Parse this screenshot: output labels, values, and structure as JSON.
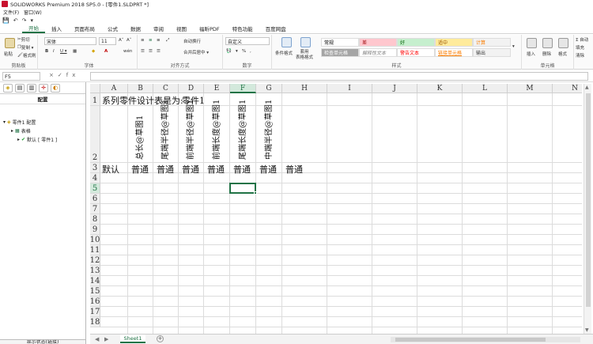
{
  "window": {
    "title": "SOLIDWORKS Premium 2018 SP5.0 - [零件1.SLDPRT *]"
  },
  "menu": [
    "文件(F)",
    "窗口(W)"
  ],
  "ribbon": {
    "tabs": [
      "开始",
      "插入",
      "页面布局",
      "公式",
      "数据",
      "审阅",
      "视图",
      "福昕PDF",
      "特色功能",
      "百度网盘"
    ],
    "clipboard": {
      "paste": "粘贴",
      "cut": "剪切",
      "copy": "复制 ▾",
      "painter": "格式刷",
      "label": "剪贴板"
    },
    "font": {
      "name": "宋体",
      "size": "11",
      "label": "字体",
      "bold": "B",
      "italic": "I",
      "underline": "U ▾",
      "grow": "A˄",
      "shrink": "A˅",
      "wen": "wén"
    },
    "alignment": {
      "wrap": "自动换行",
      "merge": "合并后居中 ▾",
      "label": "对齐方式"
    },
    "number": {
      "format": "自定义",
      "label": "数字",
      "pct": "%",
      "comma": ",",
      "currency": "▾"
    },
    "styles": {
      "cond": "条件格式",
      "table": "套用\n表格格式",
      "cells": [
        {
          "text": "常规",
          "bg": "#ffffff",
          "color": "#000000"
        },
        {
          "text": "差",
          "bg": "#ffc7ce",
          "color": "#9c0006"
        },
        {
          "text": "好",
          "bg": "#c6efce",
          "color": "#006100"
        },
        {
          "text": "适中",
          "bg": "#ffeb9c",
          "color": "#9c5700"
        },
        {
          "text": "计算",
          "bg": "#f2f2f2",
          "color": "#fa7d00"
        },
        {
          "text": "检查单元格",
          "bg": "#a5a5a5",
          "color": "#ffffff"
        },
        {
          "text": "解释性文本",
          "bg": "#ffffff",
          "color": "#7f7f7f"
        },
        {
          "text": "警告文本",
          "bg": "#ffffff",
          "color": "#ff0000"
        },
        {
          "text": "链接单元格",
          "bg": "#ffffff",
          "color": "#fa7d00"
        },
        {
          "text": "输出",
          "bg": "#f2f2f2",
          "color": "#3f3f3f"
        }
      ],
      "label": "样式"
    },
    "cells_group": {
      "insert": "插入",
      "delete": "删除",
      "format": "格式",
      "label": "单元格"
    },
    "editing": {
      "autosum": "Σ 自动",
      "fill": "填充",
      "clear": "清除"
    }
  },
  "formula_bar": {
    "name_box": "F5",
    "fx": "×✓fx",
    "value": ""
  },
  "left_panel": {
    "title": "配置",
    "tree": [
      {
        "label": "零件1 配置",
        "level": 0
      },
      {
        "label": "表格",
        "level": 1
      },
      {
        "label": "默认 [ 零件1 ]",
        "level": 2
      }
    ],
    "bottom": "显示状态(链接)"
  },
  "sheet": {
    "columns": [
      "A",
      "B",
      "C",
      "D",
      "E",
      "F",
      "G",
      "H",
      "I",
      "J",
      "K",
      "L",
      "M",
      "N"
    ],
    "rows": [
      "1",
      "2",
      "3",
      "4",
      "5",
      "6",
      "7",
      "8",
      "9",
      "10",
      "11",
      "12",
      "13",
      "14",
      "15",
      "16",
      "17",
      "18"
    ],
    "selected_col": "F",
    "selected_row": "5",
    "r1_title": "系列零件设计表是为:",
    "r1_part": "零件1",
    "r2_headers": [
      "总长@草图1",
      "尾端半径@草图1",
      "前端半径@草图1",
      "前端长度@草图1",
      "尾端长度@草图1",
      "中端半径@草图1"
    ],
    "r3_a": "默认",
    "r3_values": [
      "普通",
      "普通",
      "普通",
      "普通",
      "普通",
      "普通",
      "普通"
    ]
  },
  "sheet_tabs": {
    "active": "Sheet1"
  }
}
